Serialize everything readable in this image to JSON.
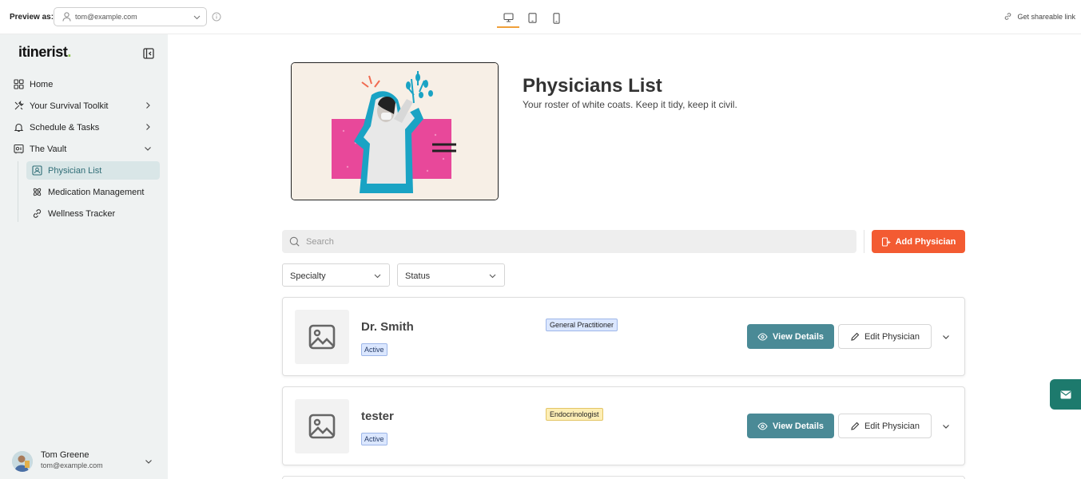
{
  "topbar": {
    "preview_label": "Preview as:",
    "preview_value": "tom@example.com",
    "share_label": "Get shareable link",
    "devices": [
      "desktop-icon",
      "tablet-icon",
      "mobile-icon"
    ],
    "active_device": "desktop-icon"
  },
  "sidebar": {
    "logo": "itinerist",
    "logo_dot": ".",
    "logo_dot_color": "#8bc34a",
    "items": [
      {
        "label": "Home",
        "icon": "grid-icon"
      },
      {
        "label": "Your Survival Toolkit",
        "icon": "tools-icon",
        "chevron": "right"
      },
      {
        "label": "Schedule & Tasks",
        "icon": "bell-icon",
        "chevron": "right"
      },
      {
        "label": "The Vault",
        "icon": "vault-icon",
        "chevron": "down"
      }
    ],
    "sub_items": [
      {
        "label": "Physician List",
        "icon": "id-card-icon",
        "active": true
      },
      {
        "label": "Medication Management",
        "icon": "atom-icon"
      },
      {
        "label": "Wellness Tracker",
        "icon": "link-icon"
      }
    ],
    "user": {
      "name": "Tom Greene",
      "email": "tom@example.com"
    }
  },
  "main": {
    "title": "Physicians List",
    "subtitle": "Your roster of white coats. Keep it tidy, keep it civil.",
    "search_placeholder": "Search",
    "add_button": "Add Physician",
    "filters": [
      "Specialty",
      "Status"
    ],
    "view_label": "View Details",
    "edit_label": "Edit Physician",
    "physicians": [
      {
        "name": "Dr. Smith",
        "status": "Active",
        "specialty": "General Practitioner",
        "specialty_bg": "#dbe7ff",
        "specialty_border": "#9db6e8"
      },
      {
        "name": "tester",
        "status": "Active",
        "specialty": "Endocrinologist",
        "specialty_bg": "#fdeeb5",
        "specialty_border": "#e3c566"
      }
    ]
  },
  "colors": {
    "accent_orange": "#f35b32",
    "teal_button": "#4a8a96",
    "mail_tab": "#1d7a6d",
    "sidebar_bg": "#eff2f2"
  }
}
